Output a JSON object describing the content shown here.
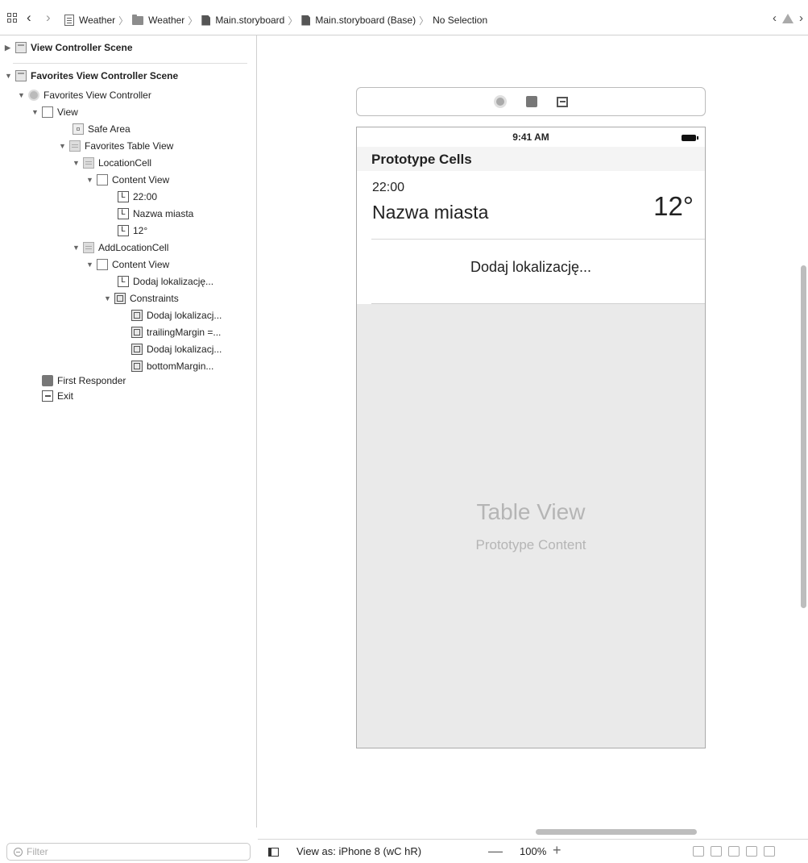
{
  "jumpbar": {
    "crumbs": [
      "Weather",
      "Weather",
      "Main.storyboard",
      "Main.storyboard (Base)",
      "No Selection"
    ]
  },
  "outline": {
    "scene1": "View Controller Scene",
    "scene2": "Favorites View Controller Scene",
    "items": [
      "Favorites View Controller",
      "View",
      "Safe Area",
      "Favorites Table View",
      "LocationCell",
      "Content View",
      "22:00",
      "Nazwa miasta",
      "12°",
      "AddLocationCell",
      "Content View",
      "Dodaj lokalizację...",
      "Constraints",
      "Dodaj lokalizacj...",
      "trailingMargin =...",
      "Dodaj lokalizacj...",
      "bottomMargin...",
      "First Responder",
      "Exit"
    ],
    "filter_placeholder": "Filter"
  },
  "device": {
    "status_time": "9:41 AM",
    "prototype_header": "Prototype Cells",
    "cell_time": "22:00",
    "cell_city": "Nazwa miasta",
    "cell_temp": "12°",
    "add_location": "Dodaj lokalizację...",
    "table_title": "Table View",
    "table_subtitle": "Prototype Content"
  },
  "bottombar": {
    "view_as": "View as: iPhone 8 (wC hR)",
    "zoom": "100%",
    "minus": "—",
    "plus": "+"
  }
}
